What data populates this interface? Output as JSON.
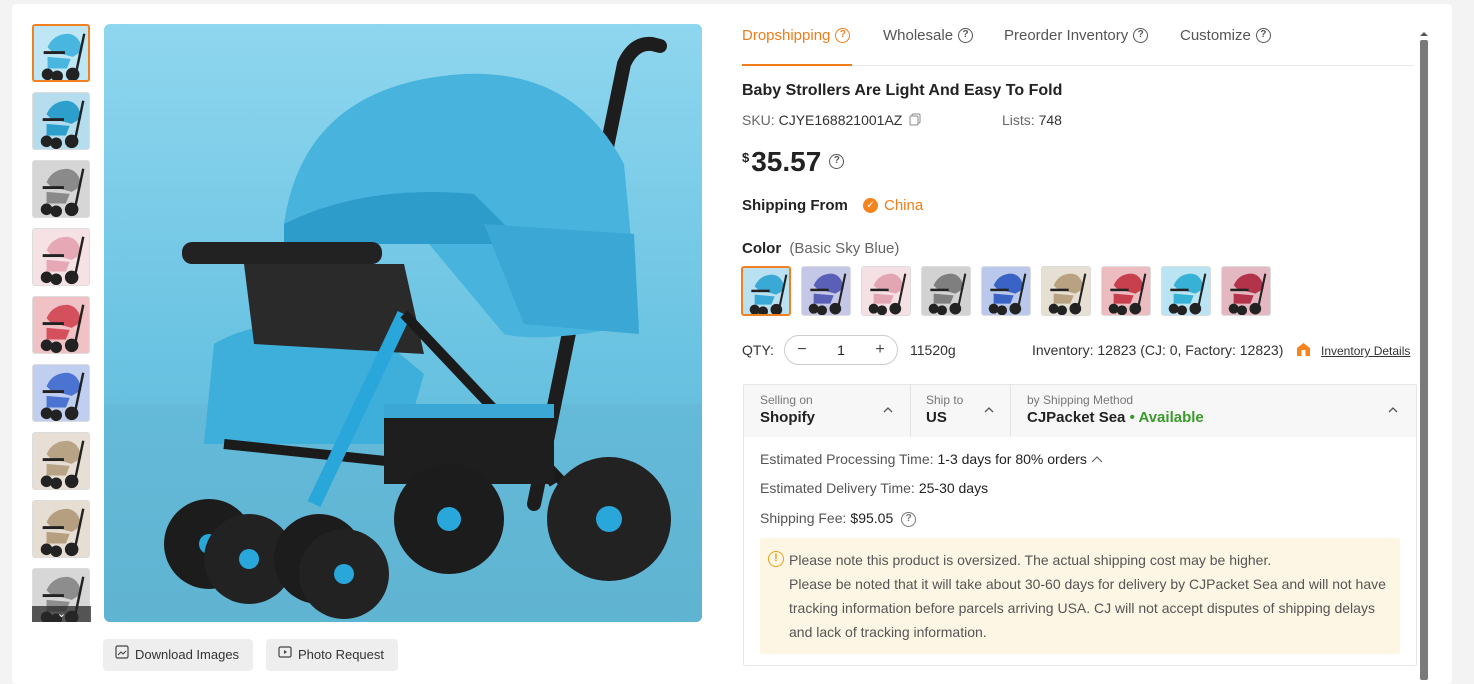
{
  "thumbnails": {
    "colors": [
      "#49b6df",
      "#2c9fcd",
      "#8a8a8a",
      "#e6a8b4",
      "#d4505c",
      "#4b74d2",
      "#b9a386",
      "#b69f80",
      "#8d8d8d"
    ],
    "more_icon": "chevron-down-icon"
  },
  "image_actions": {
    "download_label": "Download Images",
    "photo_request_label": "Photo Request"
  },
  "tabs": [
    {
      "label": "Dropshipping"
    },
    {
      "label": "Wholesale"
    },
    {
      "label": "Preorder Inventory"
    },
    {
      "label": "Customize"
    }
  ],
  "product": {
    "title": "Baby Strollers Are Light And Easy To Fold",
    "sku_label": "SKU:",
    "sku": "CJYE168821001AZ",
    "lists_label": "Lists:",
    "lists": "748",
    "currency": "$",
    "price": "35.57"
  },
  "shipping_from": {
    "label": "Shipping From",
    "location": "China"
  },
  "color": {
    "label": "Color",
    "selected": "(Basic Sky Blue)",
    "swatches": [
      "#3aa9d6",
      "#5a5fb8",
      "#e2a6b3",
      "#7f7f7f",
      "#3a63c6",
      "#b8a282",
      "#c8404d",
      "#38b1d6",
      "#b3344a"
    ]
  },
  "quantity": {
    "label": "QTY:",
    "value": "1",
    "minus": "−",
    "plus": "+",
    "weight": "11520g"
  },
  "inventory": {
    "text": "Inventory: 12823",
    "breakdown": "(CJ: 0, Factory: 12823)",
    "link": "Inventory Details"
  },
  "shipping": {
    "selling_on_label": "Selling on",
    "selling_on": "Shopify",
    "ship_to_label": "Ship to",
    "ship_to": "US",
    "method_label": "by Shipping Method",
    "method": "CJPacket Sea",
    "availability": "• Available",
    "processing_label": "Estimated Processing Time:",
    "processing": "1-3 days for 80% orders",
    "delivery_label": "Estimated Delivery Time:",
    "delivery": "25-30 days",
    "fee_label": "Shipping Fee:",
    "fee": "$95.05"
  },
  "notice": {
    "line1": "Please note this product is oversized. The actual shipping cost may be higher.",
    "line2": "Please be noted that it will take about 30-60 days for delivery by CJPacket Sea and will not have tracking information before parcels arriving USA. CJ will not accept disputes of shipping delays and lack of tracking information."
  },
  "accent_color": "#f07c1a"
}
